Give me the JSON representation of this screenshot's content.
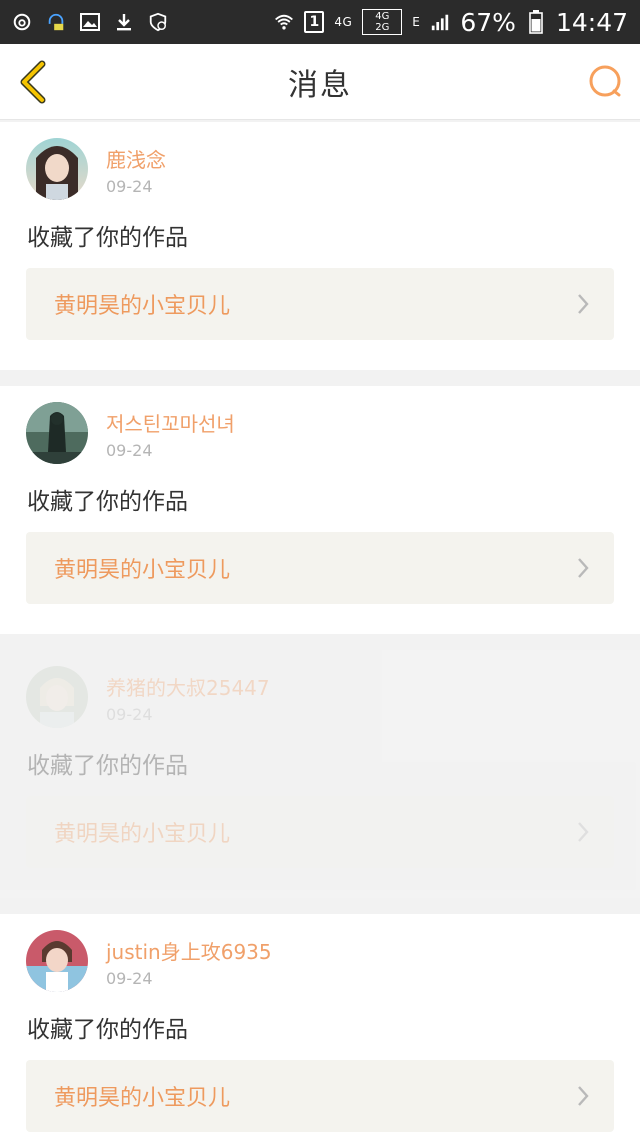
{
  "status_bar": {
    "network_4g": "4G",
    "network_4g_box": "4G",
    "network_2g_box": "2G",
    "edge": "E",
    "battery": "67%",
    "time": "14:47",
    "sim_number": "1"
  },
  "header": {
    "title": "消息"
  },
  "colors": {
    "accent": "#f0a06a",
    "back_icon": "#f5c400",
    "search_icon": "#f7a05c"
  },
  "messages": [
    {
      "username": "鹿浅念",
      "date": "09-24",
      "action": "收藏了你的作品",
      "work_title": "黄明昊的小宝贝儿"
    },
    {
      "username": "저스틴꼬마선녀",
      "date": "09-24",
      "action": "收藏了你的作品",
      "work_title": "黄明昊的小宝贝儿"
    },
    {
      "username": "养猪的大叔25447",
      "date": "09-24",
      "action": "收藏了你的作品",
      "work_title": "黄明昊的小宝贝儿"
    },
    {
      "username": "justin身上攻6935",
      "date": "09-24",
      "action": "收藏了你的作品",
      "work_title": "黄明昊的小宝贝儿"
    }
  ]
}
